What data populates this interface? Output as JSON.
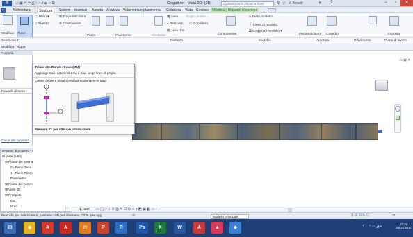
{
  "window": {
    "title": "Clegatt.rvt - Vista 3D: {3D}",
    "search_placeholder": "Digitare parola chiave o frase",
    "sign_in": "Accedi",
    "help_label": "?"
  },
  "tabs": [
    {
      "label": "Architettura"
    },
    {
      "label": "Struttura"
    },
    {
      "label": "Sistemi"
    },
    {
      "label": "Inserisci"
    },
    {
      "label": "Annota"
    },
    {
      "label": "Analizza"
    },
    {
      "label": "Volumetria e planimetria"
    },
    {
      "label": "Collabora"
    },
    {
      "label": "Vista"
    },
    {
      "label": "Gestisci"
    },
    {
      "label": "Modifica | Riquadri di sezione"
    }
  ],
  "ribbon": {
    "modify_label": "Modifica",
    "trave_label": "Trave",
    "muro_label": "Muro",
    "trave_reticolare_label": "Trave reticolare",
    "pilastro_label": "Pilastro",
    "controvento_label": "Controvento",
    "piano_label": "Piatto",
    "pavimento_label": "Pavimento",
    "armatura_label": "Armatura",
    "area_label": "Area",
    "foglio_label": "Foglio di rete",
    "percorso_label": "Percorso",
    "copriferro_label": "Copriferro",
    "area_rete_label": "Area rete",
    "componente_label": "Componente",
    "testo_modello_label": "Testo modello",
    "linea_modello_label": "Linea di modello",
    "gruppo_modello_label": "Gruppo di modello",
    "perpendicolare_label": "Perpendicolare",
    "cavedio_label": "Cavedio",
    "imposta_label": "Imposta",
    "panel_rinforzo": "Rinforzo",
    "panel_modello": "Modello",
    "panel_apertura": "Apertura",
    "panel_riferimento": "Riferimento",
    "panel_piano_lavoro": "Piano di lavoro"
  },
  "options": {
    "selection_label": "Selezione",
    "context_label": "Modifica | Riqua"
  },
  "properties": {
    "header": "Proprietà",
    "type_label": "Riquadri di sezio",
    "help_link": "Guida alle proprietà",
    "apply_button": "Applica"
  },
  "tooltip": {
    "title": "Telaio strutturale: trave (BM)",
    "description": "Aggiunge travi, catene di travi o travi lungo linee di griglia.",
    "hint": "Creare griglie e pilastri prima di aggiungere le travi.",
    "footer": "Premere F1 per ulteriori informazioni"
  },
  "browser": {
    "title": "Browser di progetto - Clegatt.rvt",
    "items": [
      {
        "label": "Viste (tutto)",
        "level": 0,
        "prefix": "⊟"
      },
      {
        "label": "Piante dei pavimenti",
        "level": 1,
        "prefix": "⊟"
      },
      {
        "label": "0 - Piano Terra",
        "level": 2,
        "prefix": ""
      },
      {
        "label": "1 - Piano Primo",
        "level": 2,
        "prefix": ""
      },
      {
        "label": "Planimetria",
        "level": 2,
        "prefix": ""
      },
      {
        "label": "Piante del controsoffitto",
        "level": 1,
        "prefix": "⊞"
      },
      {
        "label": "Viste 3D",
        "level": 1,
        "prefix": "⊞"
      },
      {
        "label": "Prospetti",
        "level": 1,
        "prefix": "⊟"
      },
      {
        "label": "Est",
        "level": 2,
        "prefix": ""
      },
      {
        "label": "Nord",
        "level": 2,
        "prefix": ""
      }
    ]
  },
  "viewbar": {
    "scale": "1 : 100"
  },
  "statusbar": {
    "message": "Fare clic per selezionare, premere TAB per alternare, CTRL per agg",
    "zero": ":0",
    "model": "Modello principale",
    "right_value": ":0"
  },
  "taskbar": {
    "time": "13:22",
    "date": "26/01/2017",
    "language": "IT"
  },
  "colors": {
    "title_bar": "#dde6f0",
    "context_tab": "#c8e2c0",
    "taskbar": "#1f3f77",
    "beam_highlight": "#3f6fd6"
  }
}
